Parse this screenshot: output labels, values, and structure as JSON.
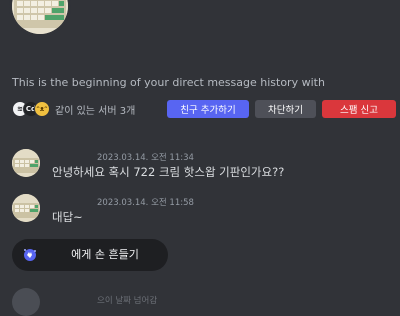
{
  "dm": {
    "intro": "This is the beginning of your direct message history with",
    "mutual_servers": "같이 있는 서버 3개",
    "server_icons": [
      {
        "name": "server-icon-1",
        "color": "#f2f3f5",
        "glyph": "≋"
      },
      {
        "name": "server-icon-2",
        "color": "#202225",
        "glyph": "Cd"
      },
      {
        "name": "server-icon-3",
        "color": "#f0c040",
        "glyph": "🐱"
      }
    ],
    "buttons": {
      "add_friend": "친구 추가하기",
      "block": "차단하기",
      "report_spam": "스팸 신고"
    }
  },
  "messages": [
    {
      "timestamp": "2023.03.14. 오전 11:34",
      "text": "안녕하세요 혹시 722 크림 핫스왑 기판인가요??"
    },
    {
      "timestamp": "2023.03.14. 오전 11:58",
      "text": "대답~"
    }
  ],
  "wave": {
    "label": "에게 손 흔들기",
    "icon": "wave-sticker-icon"
  },
  "partial_message": {
    "text": "으이 날짜 넘어감"
  },
  "colors": {
    "background": "#313338",
    "blurple": "#5865f2",
    "danger": "#da373c",
    "secondary": "#4e5058"
  }
}
